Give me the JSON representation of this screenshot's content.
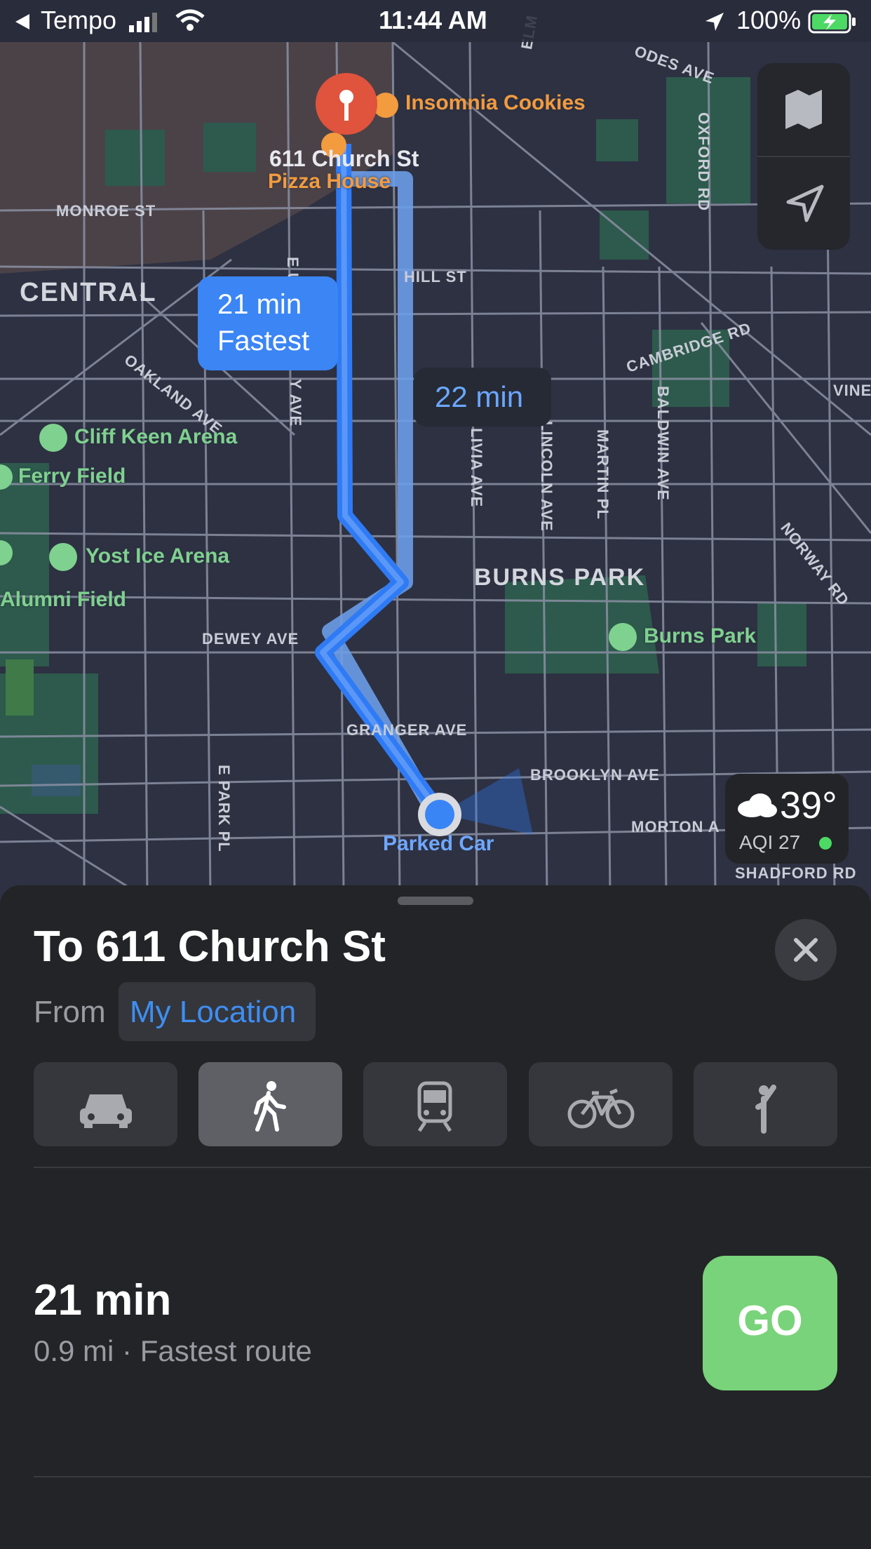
{
  "status_bar": {
    "back_app": "Tempo",
    "time": "11:44 AM",
    "battery": "100%"
  },
  "map": {
    "destination_address": "611 Church St",
    "pois": {
      "insomnia_cookies": "Insomnia Cookies",
      "pizza_house": "Pizza House",
      "cliff_keen_arena": "Cliff Keen Arena",
      "ferry_field": "Ferry Field",
      "yost_ice_arena": "Yost Ice Arena",
      "alumni_field": "Alumni Field",
      "burns_park_poi": "Burns Park",
      "parked_car": "Parked Car"
    },
    "districts": {
      "central": "CENTRAL",
      "burns_park": "BURNS PARK"
    },
    "streets": {
      "monroe": "MONROE ST",
      "hill": "HILL ST",
      "oakland": "OAKLAND AVE",
      "cambridge": "CAMBRIDGE RD",
      "vine": "VINE",
      "norway": "NORWAY RD",
      "livia": "LIVIA AVE",
      "lincoln": "LINCOLN AVE",
      "martin": "MARTIN PL",
      "baldwin": "BALDWIN AVE",
      "oxford": "OXFORD RD",
      "elm": "ELM",
      "rhodes": "ODES AVE",
      "dewey": "DEWEY AVE",
      "granger": "GRANGER AVE",
      "brooklyn": "BROOKLYN AVE",
      "morton": "MORTON A",
      "shadford": "SHADFORD RD",
      "epark": "E PARK PL",
      "eu_partial": "E U",
      "y_ave": "Y AVE"
    },
    "route_fastest": {
      "time": "21 min",
      "label": "Fastest"
    },
    "route_alt": {
      "time": "22 min"
    },
    "weather": {
      "temp": "39°",
      "aqi": "AQI 27"
    }
  },
  "sheet": {
    "title": "To 611 Church St",
    "from_label": "From",
    "from_value": "My Location",
    "modes": [
      "car-icon",
      "walk-icon",
      "transit-icon",
      "bike-icon",
      "rideshare-icon"
    ],
    "active_mode": "walk",
    "route": {
      "duration": "21 min",
      "details": "0.9 mi · Fastest route",
      "go_label": "GO"
    }
  },
  "colors": {
    "route": "#2f7bf5",
    "route_alt": "#6b9de8",
    "go": "#79d37a",
    "accent_blue": "#3e8ef2",
    "pin": "#e0533c",
    "park_green": "#2c5a4d"
  }
}
